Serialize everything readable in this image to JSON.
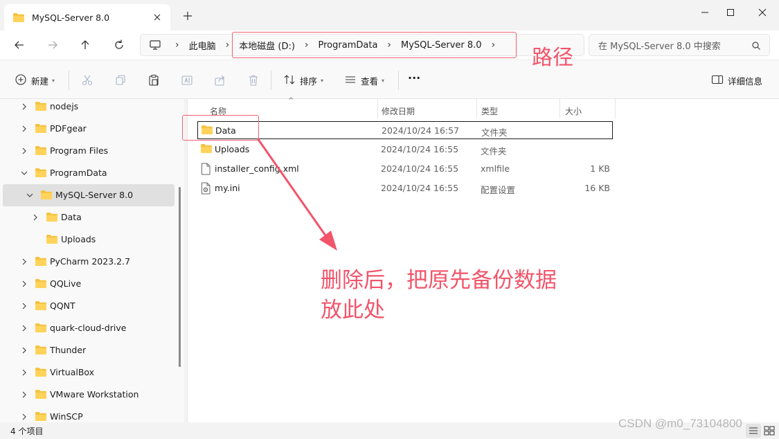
{
  "window": {
    "tab_title": "MySQL-Server 8.0"
  },
  "breadcrumb": [
    "此电脑",
    "本地磁盘 (D:)",
    "ProgramData",
    "MySQL-Server 8.0"
  ],
  "search": {
    "placeholder": "在 MySQL-Server 8.0 中搜索"
  },
  "toolbar": {
    "new_label": "新建",
    "sort_label": "排序",
    "view_label": "查看",
    "more_label": "···",
    "details_label": "详细信息"
  },
  "sidebar": {
    "items": [
      {
        "label": "nodejs",
        "expanded": false,
        "indent": 0
      },
      {
        "label": "PDFgear",
        "expanded": false,
        "indent": 0
      },
      {
        "label": "Program Files",
        "expanded": false,
        "indent": 0
      },
      {
        "label": "ProgramData",
        "expanded": true,
        "indent": 0
      },
      {
        "label": "MySQL-Server 8.0",
        "expanded": true,
        "indent": 1,
        "selected": true
      },
      {
        "label": "Data",
        "expanded": false,
        "indent": 2
      },
      {
        "label": "Uploads",
        "expanded": null,
        "indent": 2
      },
      {
        "label": "PyCharm 2023.2.7",
        "expanded": false,
        "indent": 0
      },
      {
        "label": "QQLive",
        "expanded": false,
        "indent": 0
      },
      {
        "label": "QQNT",
        "expanded": false,
        "indent": 0
      },
      {
        "label": "quark-cloud-drive",
        "expanded": false,
        "indent": 0
      },
      {
        "label": "Thunder",
        "expanded": false,
        "indent": 0
      },
      {
        "label": "VirtualBox",
        "expanded": false,
        "indent": 0
      },
      {
        "label": "VMware Workstation",
        "expanded": false,
        "indent": 0
      },
      {
        "label": "WinSCP",
        "expanded": false,
        "indent": 0
      }
    ]
  },
  "columns": {
    "name": "名称",
    "modified": "修改日期",
    "type": "类型",
    "size": "大小"
  },
  "files": [
    {
      "name": "Data",
      "modified": "2024/10/24 16:57",
      "type": "文件夹",
      "size": "",
      "icon": "folder-icon"
    },
    {
      "name": "Uploads",
      "modified": "2024/10/24 16:55",
      "type": "文件夹",
      "size": "",
      "icon": "folder-icon"
    },
    {
      "name": "installer_config.xml",
      "modified": "2024/10/24 16:55",
      "type": "xmlfile",
      "size": "1 KB",
      "icon": "file-icon"
    },
    {
      "name": "my.ini",
      "modified": "2024/10/24 16:55",
      "type": "配置设置",
      "size": "16 KB",
      "icon": "settings-file-icon"
    }
  ],
  "status": {
    "count": "4 个项目"
  },
  "annotations": {
    "path_label": "路径",
    "note_line1": "删除后，把原先备份数据",
    "note_line2": "放此处",
    "color": "#f2546a"
  },
  "watermark": "CSDN @m0_73104800"
}
